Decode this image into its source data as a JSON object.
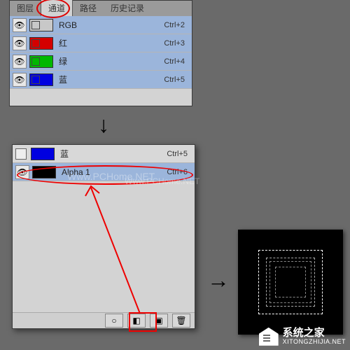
{
  "tabs": {
    "layers": "图层",
    "channels": "通道",
    "paths": "路径",
    "history": "历史记录"
  },
  "top_channels": [
    {
      "name": "RGB",
      "shortcut": "Ctrl+2",
      "color": "#c8c8c8"
    },
    {
      "name": "红",
      "shortcut": "Ctrl+3",
      "color": "#d40000"
    },
    {
      "name": "绿",
      "shortcut": "Ctrl+4",
      "color": "#00b800"
    },
    {
      "name": "蓝",
      "shortcut": "Ctrl+5",
      "color": "#0000e0"
    }
  ],
  "bottom_channels": [
    {
      "name": "蓝",
      "shortcut": "Ctrl+5",
      "color": "#0000e0",
      "selected": false,
      "eye": false
    },
    {
      "name": "Alpha 1",
      "shortcut": "Ctrl+6",
      "color": "#000000",
      "selected": true,
      "eye": true
    }
  ],
  "watermarks": {
    "w1": "Www.PCHome.NET",
    "w2": "Www.PCHome.NET"
  },
  "branding": {
    "cn": "系统之家",
    "url": "XITONGZHIJIA.NET"
  }
}
